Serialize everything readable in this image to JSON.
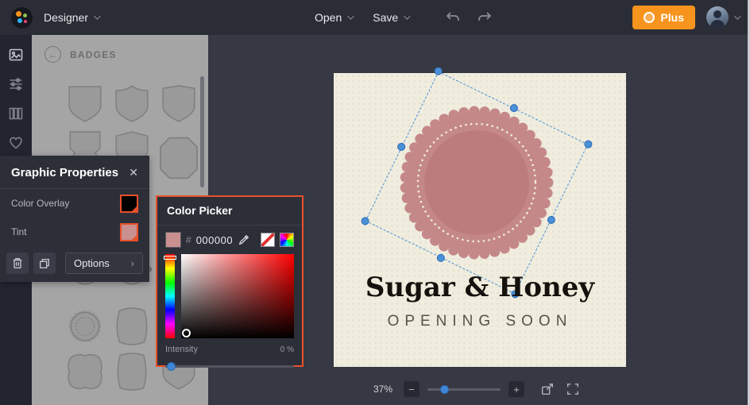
{
  "topbar": {
    "app_label": "Designer",
    "open_label": "Open",
    "save_label": "Save",
    "plus_label": "Plus"
  },
  "badges_panel": {
    "title": "BADGES",
    "back_glyph": "←"
  },
  "graphic_properties": {
    "title": "Graphic Properties",
    "close_glyph": "✕",
    "color_overlay_label": "Color Overlay",
    "color_overlay_value": "#000000",
    "color_overlay_style": "background:#000000",
    "tint_label": "Tint",
    "tint_value": "#c9908f",
    "tint_style": "background:#c9908f",
    "options_label": "Options",
    "options_chevron": "›"
  },
  "panel_collapse_chevron": "›",
  "color_picker": {
    "title": "Color Picker",
    "hex_prefix": "#",
    "hex_value": "000000",
    "current_color": "#c9908f",
    "current_style": "background:#c9908f",
    "intensity_label": "Intensity",
    "intensity_value": "0 %"
  },
  "canvas": {
    "heading": "Sugar & Honey",
    "subheading": "OPENING SOON"
  },
  "zoom_bar": {
    "zoom_value": "37%",
    "minus_glyph": "−",
    "plus_glyph": "+"
  },
  "colors": {
    "accent_orange": "#f7941e",
    "highlight_red": "#e8502a",
    "selection_blue": "#4a90d8",
    "badge_rose": "#c58888",
    "badge_rose_inner": "#bd7c7c",
    "artboard_cream": "#f0eddf"
  }
}
